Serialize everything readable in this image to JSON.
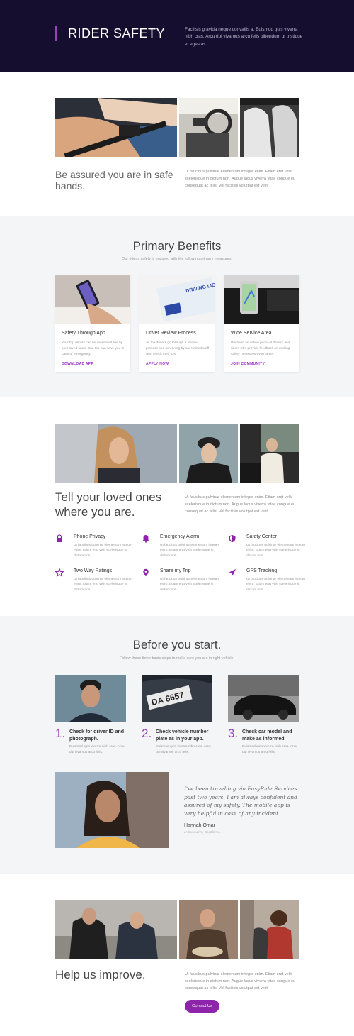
{
  "hero": {
    "title": "RIDER SAFETY",
    "description": "Facilisis gravida neque convallis a. Euismod quis viverra nibh cras. Arcu dui vivamus arcu felis bibendum ut tristique et egestas."
  },
  "assured": {
    "heading": "Be assured you are in safe hands.",
    "text": "Ut faucibus pulvinar elementum integer enim. Etiam erat velit scelerisque in dictum non. Augue lacus viverra vitae congue eu consequat ac felis. Vel facilisis volutpat est velit."
  },
  "benefits": {
    "title": "Primary Benefits",
    "subtitle": "Our rider's safety is ensured with the following primary measures.",
    "cards": [
      {
        "title": "Safety Through App",
        "text": "Your trip details can be monitored live by your loved ones. One tap can save you in case of emergency.",
        "link": "DOWNLOAD APP"
      },
      {
        "title": "Driver Review Process",
        "text": "All the drivers go through a review process and screening by our trained staff who check their IDs.",
        "link": "APPLY NOW"
      },
      {
        "title": "Wide Service Area",
        "text": "We have an online portal of drivers and riders who provide feedback on making safety measures even better.",
        "link": "JOIN COMMUNITY"
      }
    ]
  },
  "loved": {
    "heading": "Tell your loved ones where you are.",
    "text": "Ut faucibus pulvinar elementum integer enim. Etiam erat velit scelerisque in dictum non. Augue lacus viverra vitae congue eu consequat ac felis. Vel facilisis volutpat est velit.",
    "features": [
      {
        "title": "Phone Privacy",
        "icon": "lock-icon",
        "text": "Ut faucibus pulvinar elementum integer enim. Etiam erat velit scelerisque in dictum non."
      },
      {
        "title": "Emergency Alarm",
        "icon": "bell-icon",
        "text": "Ut faucibus pulvinar elementum integer enim. Etiam erat velit scelerisque in dictum non."
      },
      {
        "title": "Safety Center",
        "icon": "shield-icon",
        "text": "Ut faucibus pulvinar elementum integer enim. Etiam erat velit scelerisque in dictum non."
      },
      {
        "title": "Two Way Ratings",
        "icon": "star-icon",
        "text": "Ut faucibus pulvinar elementum integer enim. Etiam erat velit scelerisque in dictum non."
      },
      {
        "title": "Share my Trip",
        "icon": "location-pin-icon",
        "text": "Ut faucibus pulvinar elementum integer enim. Etiam erat velit scelerisque in dictum non."
      },
      {
        "title": "GPS Tracking",
        "icon": "navigation-arrow-icon",
        "text": "Ut faucibus pulvinar elementum integer enim. Etiam erat velit scelerisque in dictum non."
      }
    ]
  },
  "before": {
    "title": "Before you start.",
    "subtitle": "Follow these three basic steps to make sure you are in right vehicle.",
    "steps": [
      {
        "num": "1.",
        "title": "Check for driver ID and photograph.",
        "text": "Euismod quis viverra nibh cras. Arcu dui vivamus arcu felis."
      },
      {
        "num": "2.",
        "title": "Check vehicle number plate as in your app.",
        "text": "Euismod quis viverra nibh cras. Arcu dui vivamus arcu felis."
      },
      {
        "num": "3.",
        "title": "Check car model and make as informed.",
        "text": "Euismod quis viverra nibh cras. Arcu dui vivamus arcu felis."
      }
    ],
    "plate_text": "DA 6657",
    "testimonial": {
      "quote": "I've been travelling via EasyRide Services past two years. I am always confident and assured of my safety. The mobile app is very helpful in case of any incident.",
      "name": "Hannah Omar",
      "role": "Jr. Executive, Doodle Inc."
    }
  },
  "improve": {
    "heading": "Help us improve.",
    "text": "Ut faucibus pulvinar elementum integer enim. Etiam erat velit scelerisque in dictum non. Augue lacus viverra vitae congue eu consequat ac felis. Vel facilisis volutpat est velit.",
    "button": "Contact Us"
  },
  "colors": {
    "hero_bg": "#160e2f",
    "accent": "#9b3fbf",
    "button": "#8e24aa",
    "section_alt_bg": "#f4f5f7"
  }
}
